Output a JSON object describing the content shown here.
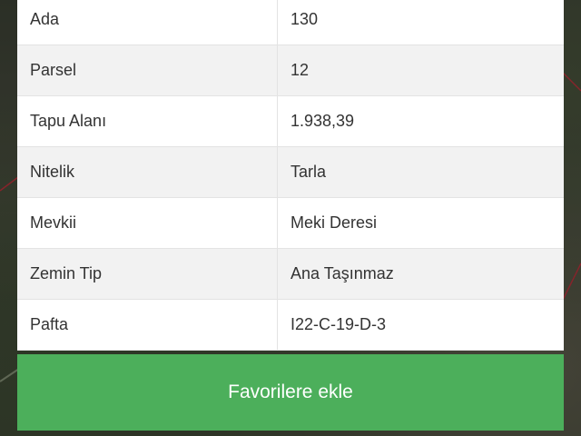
{
  "colors": {
    "button_bg": "#4caf5b",
    "panel_bg": "#ffffff",
    "row_alt_bg": "#f2f2f2",
    "text": "#333333"
  },
  "parcel_info": {
    "rows": [
      {
        "key": "Ada",
        "value": "130"
      },
      {
        "key": "Parsel",
        "value": "12"
      },
      {
        "key": "Tapu Alanı",
        "value": "1.938,39"
      },
      {
        "key": "Nitelik",
        "value": "Tarla"
      },
      {
        "key": "Mevkii",
        "value": "Meki Deresi"
      },
      {
        "key": "Zemin Tip",
        "value": "Ana Taşınmaz"
      },
      {
        "key": "Pafta",
        "value": "I22-C-19-D-3"
      }
    ]
  },
  "actions": {
    "favorite_label": "Favorilere ekle"
  }
}
